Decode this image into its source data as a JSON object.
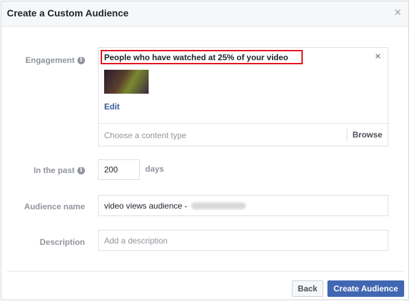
{
  "dialog": {
    "title": "Create a Custom Audience",
    "close_glyph": "×"
  },
  "engagement": {
    "label": "Engagement",
    "selected_text": "People who have watched at 25% of your video",
    "remove_glyph": "×",
    "edit_label": "Edit",
    "content_type_placeholder": "Choose a content type",
    "browse_label": "Browse"
  },
  "in_the_past": {
    "label": "In the past",
    "value": "200",
    "unit": "days"
  },
  "audience_name": {
    "label": "Audience name",
    "value": "video views audience -"
  },
  "description": {
    "label": "Description",
    "placeholder": "Add a description"
  },
  "footer": {
    "back_label": "Back",
    "create_label": "Create Audience"
  },
  "colors": {
    "primary": "#4267b2",
    "highlight": "#e3101a",
    "link": "#365899"
  },
  "info_glyph": "i"
}
